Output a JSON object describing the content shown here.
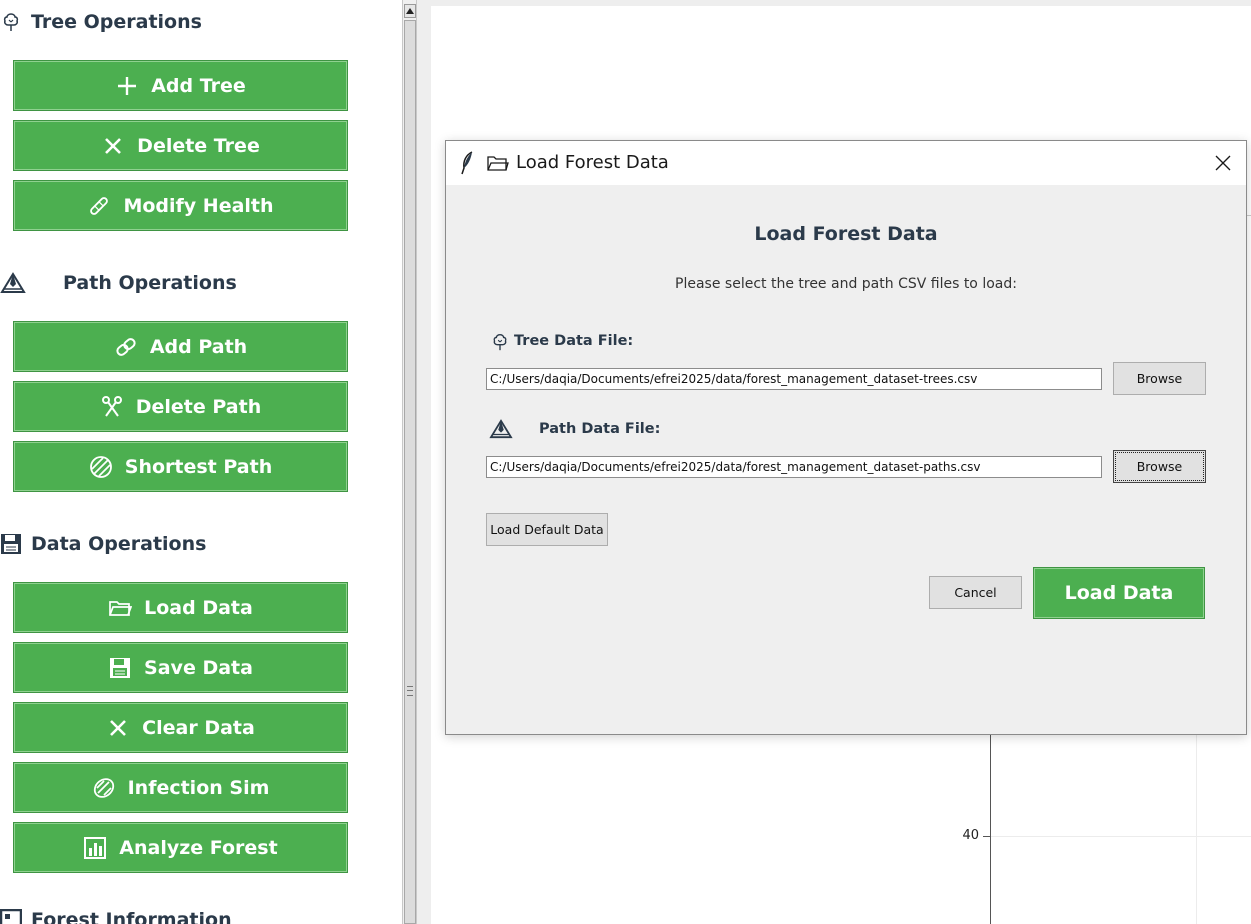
{
  "sidebar": {
    "tree_ops": {
      "title": "Tree Operations",
      "icon": "tree-icon",
      "buttons": [
        {
          "label": "Add Tree",
          "icon": "plus-icon"
        },
        {
          "label": "Delete Tree",
          "icon": "close-icon"
        },
        {
          "label": "Modify Health",
          "icon": "bandage-icon"
        }
      ]
    },
    "path_ops": {
      "title": "Path Operations",
      "icon": "mountain-icon",
      "buttons": [
        {
          "label": "Add Path",
          "icon": "link-icon"
        },
        {
          "label": "Delete Path",
          "icon": "scissors-icon"
        },
        {
          "label": "Shortest Path",
          "icon": "globe-icon"
        }
      ]
    },
    "data_ops": {
      "title": "Data Operations",
      "icon": "floppy-icon",
      "buttons": [
        {
          "label": "Load Data",
          "icon": "folder-icon"
        },
        {
          "label": "Save Data",
          "icon": "floppy-icon"
        },
        {
          "label": "Clear Data",
          "icon": "close-icon"
        },
        {
          "label": "Infection Sim",
          "icon": "virus-icon"
        },
        {
          "label": "Analyze Forest",
          "icon": "bar-chart-icon"
        }
      ]
    },
    "forest_info": {
      "title": "Forest Information"
    }
  },
  "plot": {
    "tick_label": "40"
  },
  "dialog": {
    "title": "Load Forest Data",
    "heading": "Load Forest Data",
    "instructions": "Please select the tree and path CSV files to load:",
    "tree_label": "Tree Data File:",
    "tree_path": "C:/Users/daqia/Documents/efrei2025/data/forest_management_dataset-trees.csv",
    "path_label": "Path Data File:",
    "path_path": "C:/Users/daqia/Documents/efrei2025/data/forest_management_dataset-paths.csv",
    "browse_label": "Browse",
    "default_label": "Load Default Data",
    "cancel_label": "Cancel",
    "load_label": "Load Data"
  },
  "colors": {
    "accent_green": "#4caf50",
    "heading_text": "#2b3a4a",
    "dialog_bg": "#efefef"
  }
}
